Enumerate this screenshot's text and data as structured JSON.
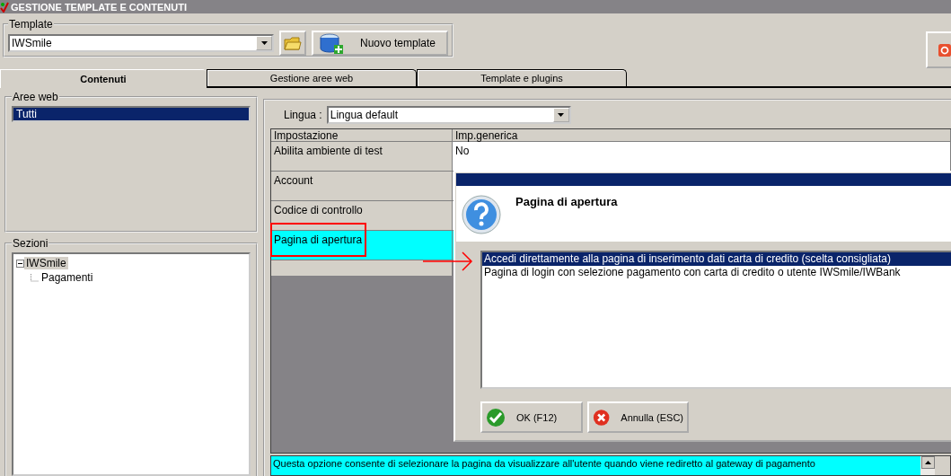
{
  "window": {
    "title": "GESTIONE TEMPLATE E CONTENUTI"
  },
  "template": {
    "label": "Template",
    "value": "IWSmile",
    "new_button": "Nuovo template"
  },
  "tabs": [
    {
      "label": "Contenuti",
      "selected": true
    },
    {
      "label": "Gestione aree web",
      "selected": false
    },
    {
      "label": "Template e plugins",
      "selected": false
    }
  ],
  "aree_web": {
    "label": "Aree web",
    "items": [
      {
        "label": "Tutti",
        "selected": true
      }
    ]
  },
  "sezioni": {
    "label": "Sezioni",
    "tree": [
      {
        "label": "IWSmile",
        "expanded": true,
        "selected": true,
        "children": [
          {
            "label": "Pagamenti",
            "selected": false
          }
        ]
      }
    ]
  },
  "lingua": {
    "label": "Lingua :",
    "value": "Lingua default"
  },
  "grid": {
    "columns": [
      "Impostazione",
      "Imp.generica"
    ],
    "rows": [
      {
        "setting": "Abilita ambiente di test",
        "value": "No",
        "selected": false
      },
      {
        "setting": "Account",
        "selected": false
      },
      {
        "setting": "Codice di controllo",
        "selected": false
      },
      {
        "setting": "Pagina di apertura",
        "selected": true
      }
    ]
  },
  "dialog": {
    "title": "Pagina di apertura",
    "options": [
      {
        "label": "Accedi direttamente alla pagina di inserimento dati carta di credito (scelta consigliata)",
        "selected": true
      },
      {
        "label": "Pagina di login con selezione pagamento con carta di credito o utente IWSmile/IWBank",
        "selected": false
      }
    ],
    "buttons": [
      {
        "kind": "ok",
        "label": "OK (F12)"
      },
      {
        "kind": "cancel",
        "label": "Annulla (ESC)"
      }
    ]
  },
  "description": "Questa opzione consente di selezionare la pagina da visualizzare all'utente quando viene rediretto al gateway di pagamento"
}
